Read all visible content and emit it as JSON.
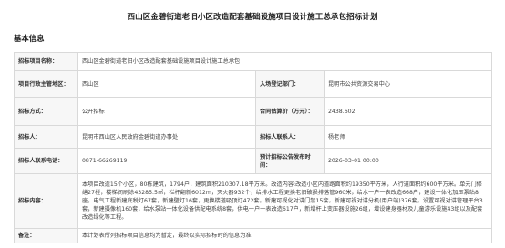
{
  "title": "西山区金碧街道老旧小区改造配套基础设施项目设计施工总承包招标计划",
  "section_label": "基本信息",
  "rows": {
    "project_name": {
      "label": "招标项目名称：",
      "value": "西山区金碧街道老旧小区改造配套基础设施项目设计施工总承包"
    },
    "region": {
      "label": "项目行政主管地区：",
      "value": "西山区"
    },
    "platform": {
      "label": "入场登记部门：",
      "value": "昆明市公共资源交易中心"
    },
    "method": {
      "label": "招标方式：",
      "value": "公开招标"
    },
    "amount": {
      "label": "合同估算价（万元）：",
      "value": "2438.602"
    },
    "tenderer": {
      "label": "招标人：",
      "value": "昆明市西山区人民政府金碧街道办事处"
    },
    "contact": {
      "label": "招标人联系人：",
      "value": "杨老师"
    },
    "phone": {
      "label": "招标人联系电话：",
      "value": "0871-66269119"
    },
    "publish_time": {
      "label": "预计招标公告发布时间：",
      "value": "2026-03-01 00:00"
    },
    "content": {
      "label": "招标内容：",
      "value": "本项目改造15个小区，80栋建筑，1794户，建筑面积210307.18平方米。改造内容:改造小区内道路面积约19350平方米，人行道面积约600平方米。单元门修缮27樘，楼梯间刷涂43285.5㎡，栏杆翻新6012m，灭火器932个，给排水工程更换老旧破损排落管960米，给水一户一表改造668户，建设一体化加压泵站8座。电气工程新建底税灯67套，新建壁灯16套，更换楼道吸顶灯472套。新建可视化对讲门禁15套，新建可视对讲分机(用户端)376套，设置可视对讲管理平台3套，新建摄像机160套，给水泵站一体化设备供配电系统8套，供电一户一表改造617户，新增杆上变压器设施26组，增设健身器材及儿童游乐设施43组以及配套改造绿化等工程。"
    },
    "remark": {
      "label": "备注：",
      "value": "本计划表所列招标项目信息均为暂定，最终以实际招标时的信息为准"
    }
  }
}
